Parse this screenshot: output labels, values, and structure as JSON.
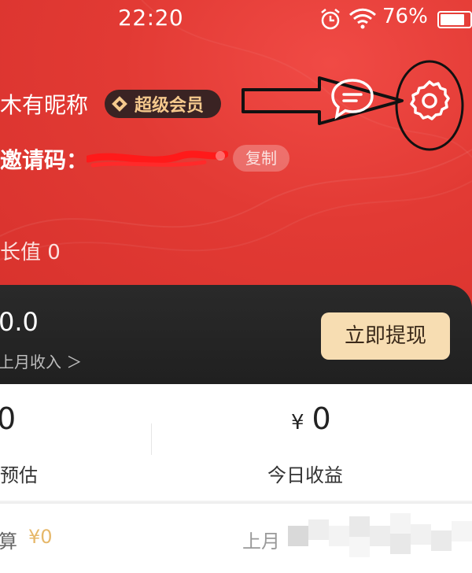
{
  "status_bar": {
    "time": "22:20",
    "battery": "76%"
  },
  "profile": {
    "nickname": "木有昵称",
    "vip_badge": "超级会员",
    "invite_label": "邀请码：",
    "copy_button": "复制",
    "growth_label": "长值 0"
  },
  "earnings": {
    "amount": "0.0",
    "last_month_link": "上月收入 ＞",
    "withdraw_button": "立即提现"
  },
  "stats": {
    "left_value": "0",
    "left_label": "预估",
    "right_currency": "¥",
    "right_value": "0",
    "right_label": "今日收益"
  },
  "summary": {
    "left_text": "算",
    "left_amount": "¥0",
    "right_text": "上月"
  },
  "colors": {
    "header_red": "#e23a34",
    "vip_gold": "#f5c98d",
    "withdraw_button_bg": "#f7ddb2",
    "dark_panel": "#222222"
  },
  "icons": [
    "alarm-icon",
    "wifi-icon",
    "battery-icon",
    "message-icon",
    "gear-icon",
    "chevron-right-icon"
  ]
}
